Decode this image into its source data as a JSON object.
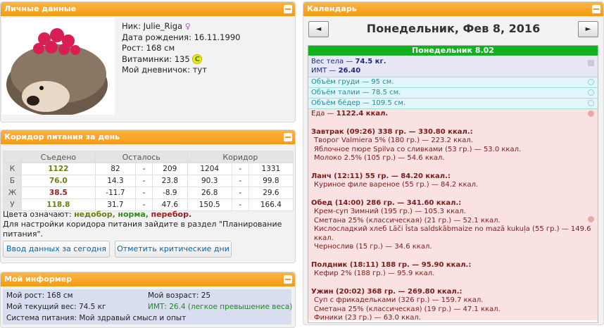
{
  "profile": {
    "title": "Личные данные",
    "nick_label": "Ник:",
    "nick": "Julie_Riga",
    "bday_label": "Дата рождения:",
    "bday": "16.11.1990",
    "height_label": "Рост:",
    "height": "168 см",
    "vitamins_label": "Витаминки:",
    "vitamins": "135",
    "coin": "C",
    "diary_label": "Мой дневничок:",
    "diary": "тут"
  },
  "corridor": {
    "title": "Коридор питания за день",
    "headers": [
      "",
      "Съедено",
      "Осталось",
      "Коридор"
    ],
    "rows": [
      {
        "k": "К",
        "eaten": "1122",
        "r1": "82",
        "r2": "209",
        "c1": "1204",
        "c2": "1331",
        "color": "#6f7e12"
      },
      {
        "k": "Б",
        "eaten": "76.0",
        "r1": "14.3",
        "r2": "23.8",
        "c1": "90.3",
        "c2": "99.8",
        "color": "#6f7e12"
      },
      {
        "k": "Ж",
        "eaten": "38.5",
        "r1": "-11.7",
        "r2": "-8.9",
        "c1": "26.8",
        "c2": "29.6",
        "color": "#9b1c1c"
      },
      {
        "k": "У",
        "eaten": "118.8",
        "r1": "31.7",
        "r2": "47.6",
        "c1": "150.5",
        "c2": "166.4",
        "color": "#6f7e12"
      }
    ],
    "dash": "-",
    "legend_prefix": "Цвета означают:",
    "legend_under": "недобор,",
    "legend_norm": "норма,",
    "legend_over": "перебор.",
    "note": "Для настройки коридора питания зайдите в раздел \"Планирование питания\".",
    "btn_today": "Ввод данных за сегодня",
    "btn_critical": "Отметить критические дни"
  },
  "informer": {
    "title": "Мой информер",
    "height": "Мой рост: 168 см",
    "age": "Мой возраст: 25",
    "weight": "Мой текущий вес: 74.5 кг",
    "bmi": "ИМТ: 26.4 (легкое превышение веса)",
    "system": "Система питания: Мой здравый смысл и опыт"
  },
  "calendar": {
    "title": "Календарь",
    "date": "Понедельник, Фев 8, 2016",
    "prev": "◄",
    "next": "►",
    "day_header": "Понедельник 8.02",
    "weight_label": "Вес тела — ",
    "weight": "74.5 кг.",
    "bmi_label": "ИМТ — ",
    "bmi": "26.40",
    "chest": "Объём груди — 95 см.",
    "waist": "Объём талии — 78.5 см.",
    "hips": "Объём бёдер — 109.5 см.",
    "food_label": "Еда — ",
    "food_total": "1122.4 ккал.",
    "meals": [
      {
        "title": "Завтрак (09:26) 338 гр. — 330.80 ккал.:",
        "items": [
          "Творог Valmiera 5% (180 гр.) — 223.2 ккал.",
          "Яблочное пюре Spilva со сливками (53 гр.) — 53.0 ккал.",
          "Молоко 2.5% (105 гр.) — 54.6 ккал."
        ]
      },
      {
        "title": "Ланч (12:11) 55 гр. — 84.20 ккал.:",
        "items": [
          "Куриное филе вареное (55 гр.) — 84.2 ккал."
        ]
      },
      {
        "title": "Обед (14:00) 286 гр. — 341.60 ккал.:",
        "items": [
          "Крем-суп Зимний (195 гр.) — 105.3 ккал.",
          "Сметана 25% (классическая) (21 гр.) — 52.1 ккал.",
          "Кислосладкий хлеб Lāči Īsta saldskābmaize no mazā kukuļa (55 гр.) — 149.6 ккал.",
          "Чернослив (15 гр.) — 34.6 ккал."
        ]
      },
      {
        "title": "Полдник (18:11) 188 гр. — 95.90 ккал.:",
        "items": [
          "Кефир 2% (188 гр.) — 95.9 ккал."
        ]
      },
      {
        "title": "Ужин (20:02) 368 гр. — 269.80 ккал.:",
        "items": [
          "Суп с фрикадельками (326 гр.) — 159.7 ккал.",
          "Сметана 25% (классическая) (19 гр.) — 47.1 ккал.",
          "Финики (23 гр.) — 63.0 ккал."
        ]
      }
    ]
  },
  "colors": {
    "header": "#f59a14",
    "under": "#6f7e12",
    "norm": "#2f8d14",
    "over": "#9b1c1c",
    "day": "#12b11f"
  }
}
